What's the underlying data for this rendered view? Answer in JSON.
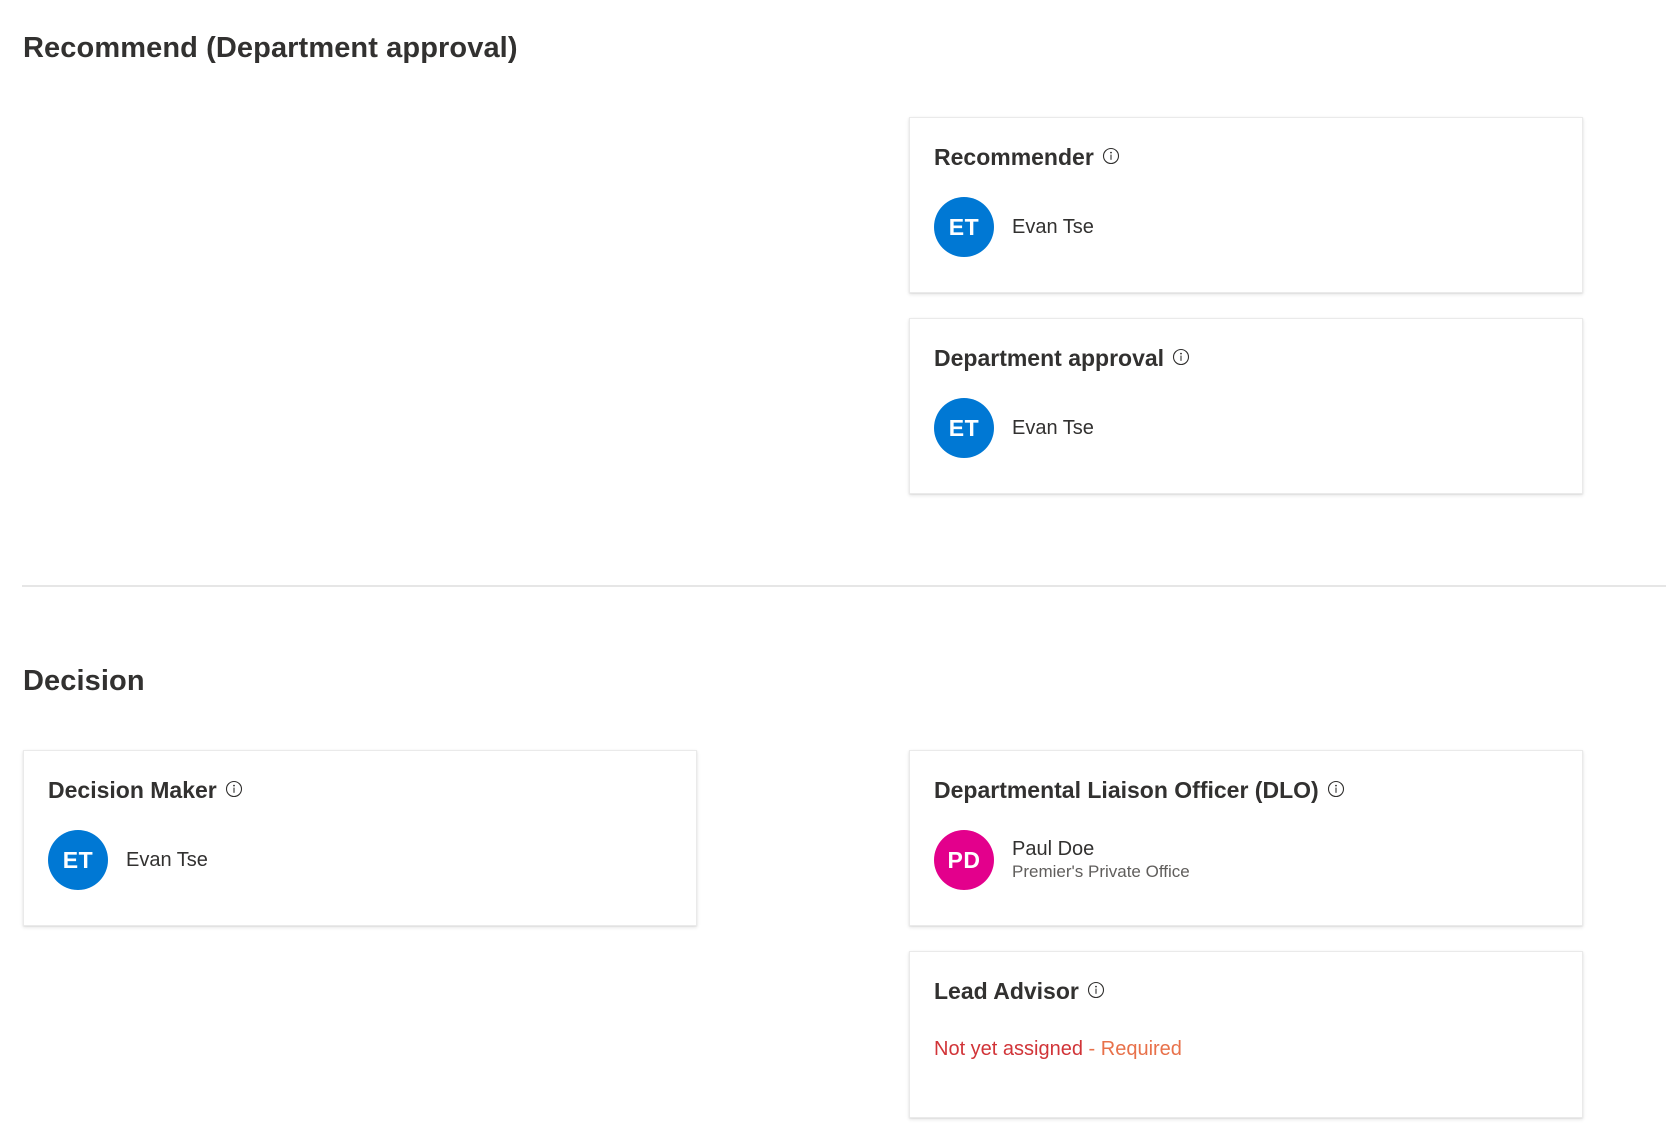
{
  "recommend_section": {
    "title": "Recommend (Department approval)",
    "cards": {
      "recommender": {
        "title": "Recommender",
        "person": {
          "initials": "ET",
          "name": "Evan Tse",
          "avatar_color": "#0078d4"
        }
      },
      "department_approval": {
        "title": "Department approval",
        "person": {
          "initials": "ET",
          "name": "Evan Tse",
          "avatar_color": "#0078d4"
        }
      }
    }
  },
  "decision_section": {
    "title": "Decision",
    "cards": {
      "decision_maker": {
        "title": "Decision Maker",
        "person": {
          "initials": "ET",
          "name": "Evan Tse",
          "avatar_color": "#0078d4"
        }
      },
      "dlo": {
        "title": "Departmental Liaison Officer (DLO)",
        "person": {
          "initials": "PD",
          "name": "Paul Doe",
          "subtitle": "Premier's Private Office",
          "avatar_color": "#e3008c"
        }
      },
      "lead_advisor": {
        "title": "Lead Advisor",
        "status": "Not yet assigned",
        "required": " - Required",
        "status_color": "#d13438"
      }
    }
  },
  "icons": {
    "info": "info-icon"
  }
}
